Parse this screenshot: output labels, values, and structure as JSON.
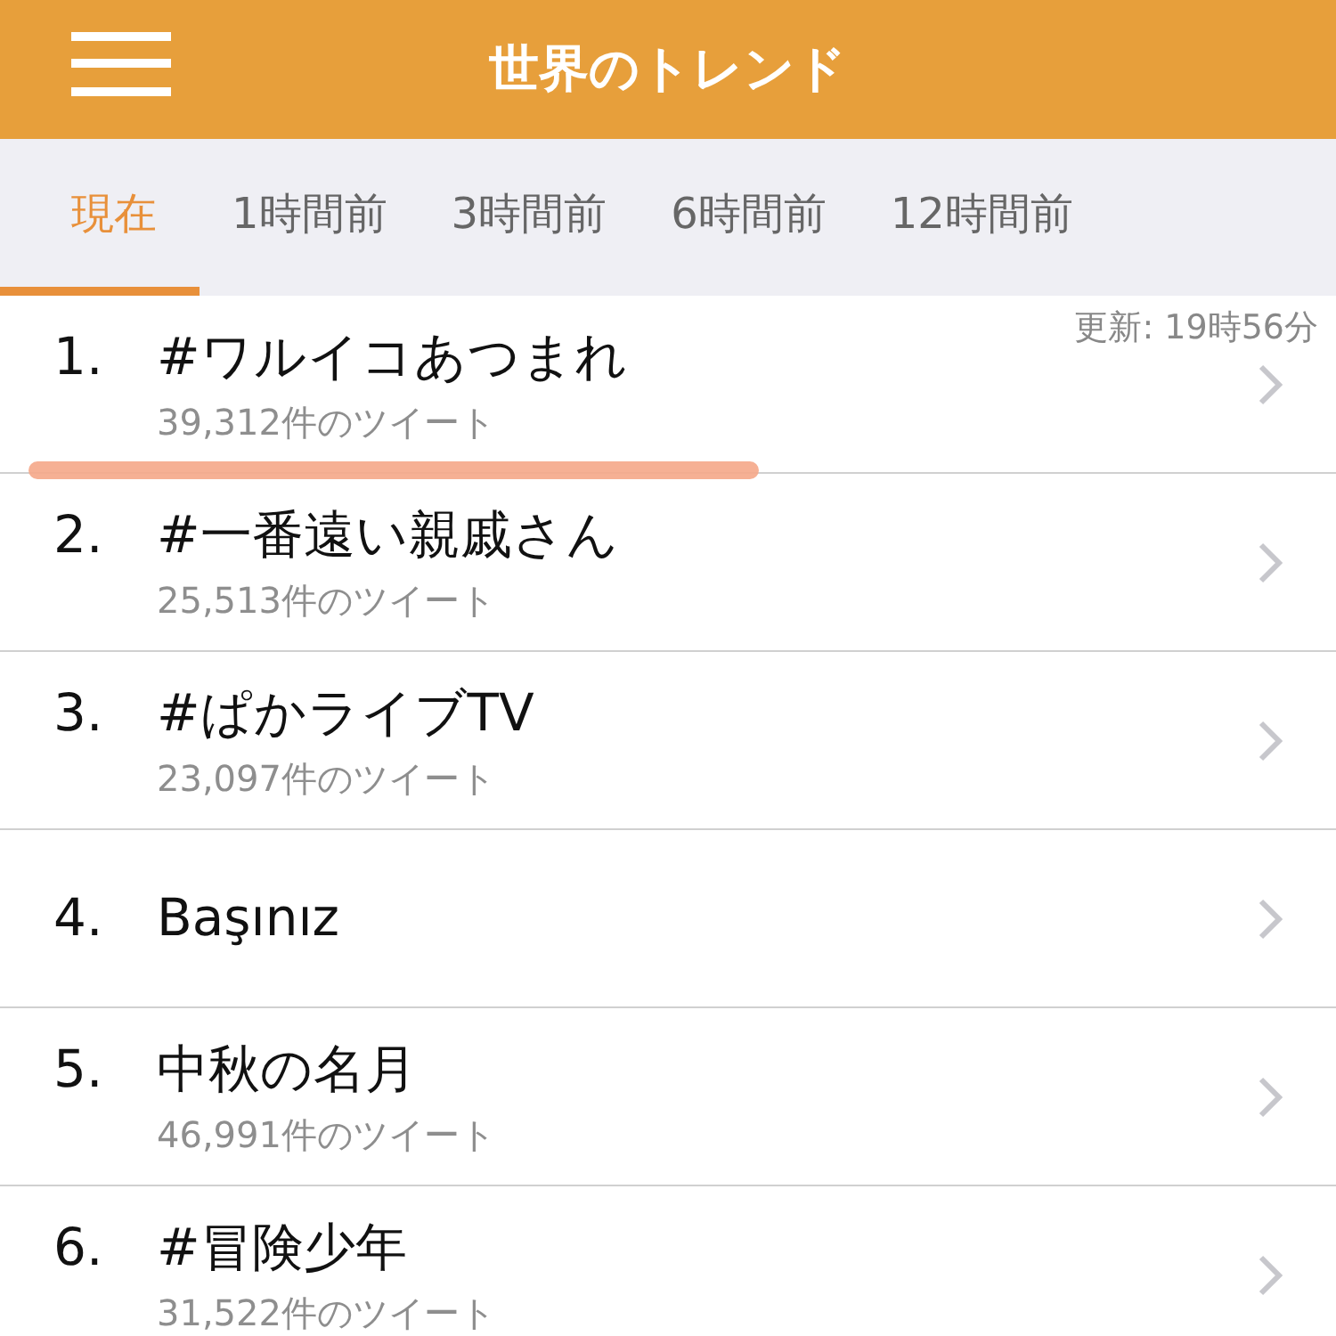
{
  "header": {
    "title": "世界のトレンド"
  },
  "tabs": [
    {
      "label": "現在",
      "selected": true
    },
    {
      "label": "1時間前",
      "selected": false
    },
    {
      "label": "3時間前",
      "selected": false
    },
    {
      "label": "6時間前",
      "selected": false
    },
    {
      "label": "12時間前",
      "selected": false
    }
  ],
  "updated": "更新: 19時56分",
  "trends": [
    {
      "rank": "1.",
      "name": "#ワルイコあつまれ",
      "tweets": "39,312件のツイート",
      "highlighted": true
    },
    {
      "rank": "2.",
      "name": "#一番遠い親戚さん",
      "tweets": "25,513件のツイート",
      "highlighted": false
    },
    {
      "rank": "3.",
      "name": "#ぱかライブTV",
      "tweets": "23,097件のツイート",
      "highlighted": false
    },
    {
      "rank": "4.",
      "name": "Başınız",
      "highlighted": false
    },
    {
      "rank": "5.",
      "name": "中秋の名月",
      "tweets": "46,991件のツイート",
      "highlighted": false
    },
    {
      "rank": "6.",
      "name": "#冒険少年",
      "tweets": "31,522件のツイート",
      "highlighted": false
    }
  ]
}
